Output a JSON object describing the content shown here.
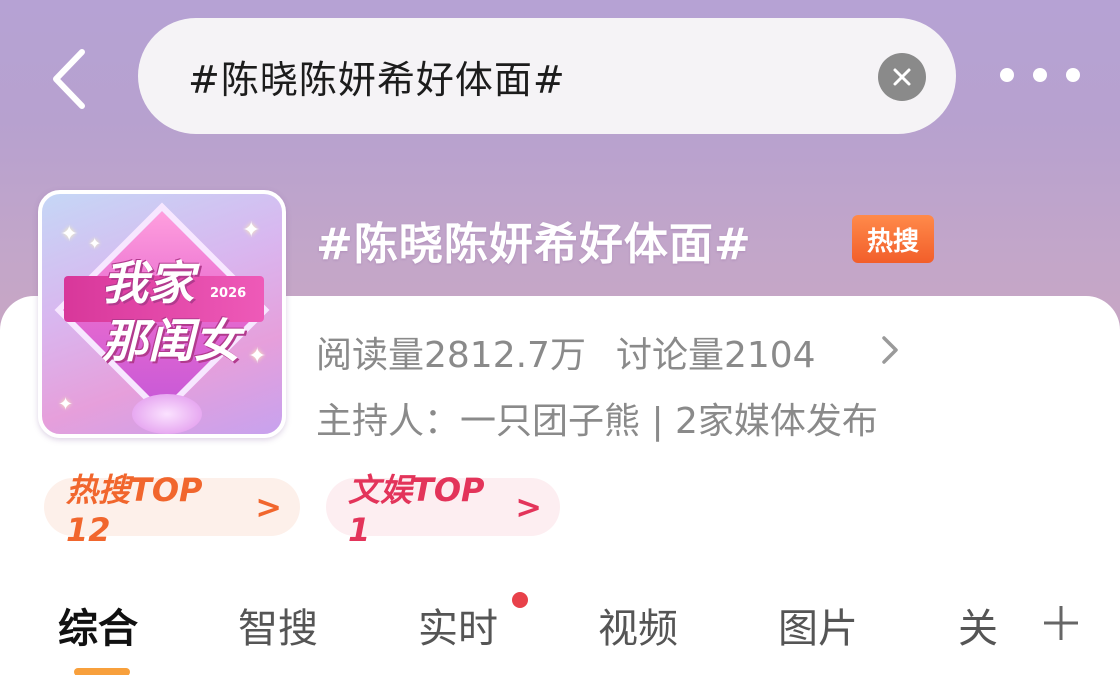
{
  "header": {
    "search_text": "#陈晓陈妍希好体面#"
  },
  "topic": {
    "title": "#陈晓陈妍希好体面#",
    "badge": "热搜",
    "reads": "阅读量2812.7万",
    "discussions": "讨论量2104",
    "host_line": "主持人：一只团子熊 | 2家媒体发布",
    "cover": {
      "title_line1": "我家",
      "title_line2": "那闺女",
      "year": "2026"
    }
  },
  "rank_pills": [
    {
      "label": "热搜TOP 12",
      "arrow": ">"
    },
    {
      "label": "文娱TOP 1",
      "arrow": ">"
    }
  ],
  "tabs": [
    {
      "label": "综合",
      "active": true
    },
    {
      "label": "智搜"
    },
    {
      "label": "实时",
      "has_dot": true
    },
    {
      "label": "视频"
    },
    {
      "label": "图片"
    },
    {
      "label": "关"
    }
  ],
  "colors": {
    "accent_orange": "#f8a03c",
    "hot_badge": "#f25e2a",
    "hot_pill_text": "#f1662d",
    "ent_pill_text": "#e3345a",
    "notification_dot": "#e8414a"
  },
  "icons": {
    "back": "chevron-left-icon",
    "clear": "close-circle-icon",
    "more": "more-dots-icon",
    "detail": "chevron-right-icon",
    "add_tab": "plus-icon"
  }
}
